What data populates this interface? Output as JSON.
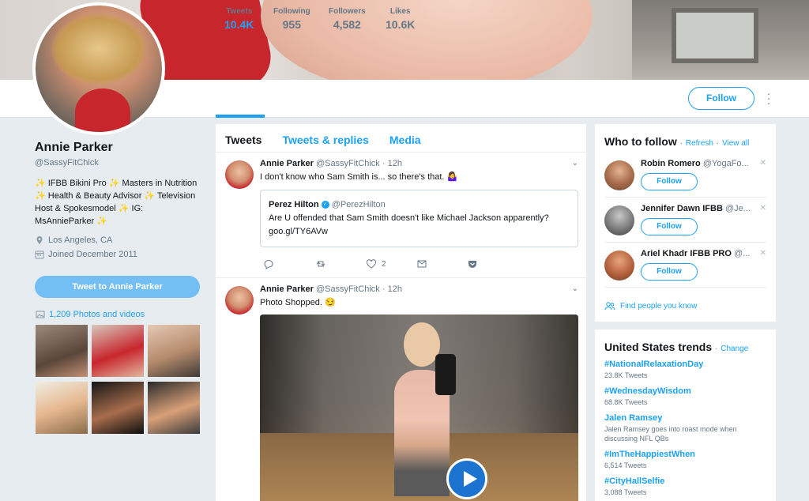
{
  "profile": {
    "name": "Annie Parker",
    "handle": "@SassyFitChick",
    "bio": "✨ IFBB Bikini Pro ✨ Masters in Nutrition ✨ Health & Beauty Advisor ✨ Television Host & Spokesmodel ✨ IG: MsAnnieParker ✨",
    "location": "Los Angeles, CA",
    "joined": "Joined December 2011",
    "tweet_to_label": "Tweet to Annie Parker",
    "photos_label": "1,209 Photos and videos"
  },
  "stats": [
    {
      "label": "Tweets",
      "value": "10.4K"
    },
    {
      "label": "Following",
      "value": "955"
    },
    {
      "label": "Followers",
      "value": "4,582"
    },
    {
      "label": "Likes",
      "value": "10.6K"
    }
  ],
  "follow_label": "Follow",
  "tabs": [
    "Tweets",
    "Tweets & replies",
    "Media"
  ],
  "tweets": [
    {
      "author": "Annie Parker",
      "handle": "@SassyFitChick",
      "time": "· 12h",
      "text": "I don't know who Sam Smith is... so there's that. 🤷‍♀️",
      "quote": {
        "author": "Perez Hilton",
        "handle": "@PerezHilton",
        "text": "Are U offended that Sam Smith doesn't like Michael Jackson apparently? goo.gl/TY6AVw"
      },
      "likes": "2"
    },
    {
      "author": "Annie Parker",
      "handle": "@SassyFitChick",
      "time": "· 12h",
      "text": "Photo Shopped. 😏"
    }
  ],
  "who_to_follow": {
    "title": "Who to follow",
    "refresh": "Refresh",
    "view_all": "View all",
    "sep": "·",
    "users": [
      {
        "name": "Robin Romero",
        "handle": "@YogaFo...",
        "button": "Follow"
      },
      {
        "name": "Jennifer Dawn IFBB",
        "handle": "@Je...",
        "button": "Follow"
      },
      {
        "name": "Ariel Khadr IFBB PRO",
        "handle": "@...",
        "button": "Follow"
      }
    ],
    "find_people": "Find people you know"
  },
  "trends": {
    "title": "United States trends",
    "change": "Change",
    "items": [
      {
        "tag": "#NationalRelaxationDay",
        "count": "23.8K Tweets"
      },
      {
        "tag": "#WednesdayWisdom",
        "count": "68.8K Tweets"
      },
      {
        "tag": "Jalen Ramsey",
        "count": "Jalen Ramsey goes into roast mode when discussing NFL QBs"
      },
      {
        "tag": "#ImTheHappiestWhen",
        "count": "6,514 Tweets"
      },
      {
        "tag": "#CityHallSelfie",
        "count": "3,088 Tweets"
      }
    ]
  },
  "colors": {
    "accent": "#1da1f2",
    "background": "#e6ecf0"
  }
}
